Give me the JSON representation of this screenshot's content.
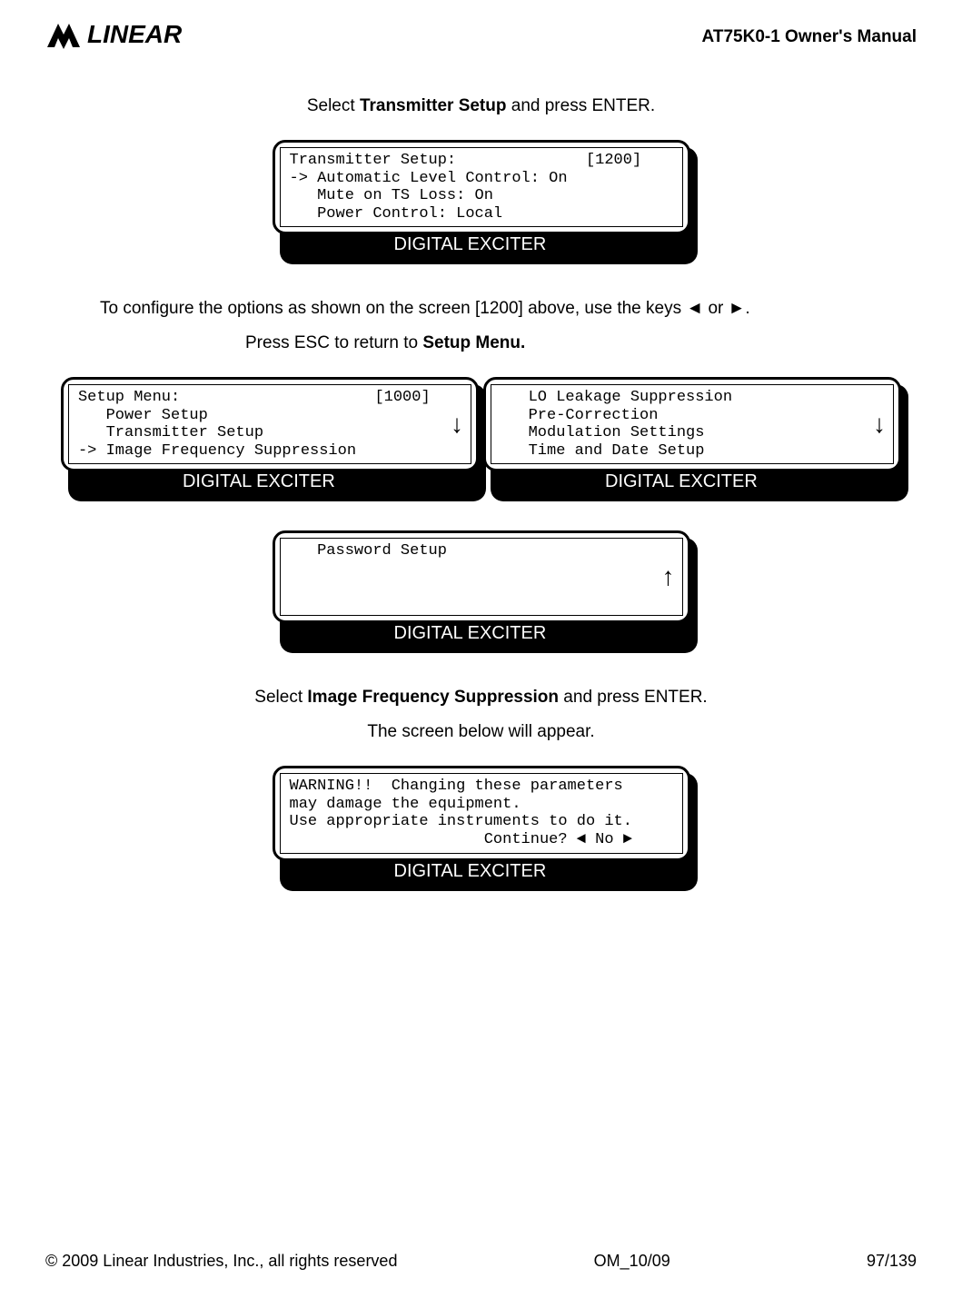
{
  "header": {
    "brand_text": "LINEAR",
    "manual_title": "AT75K0-1 Owner's Manual"
  },
  "paragraphs": {
    "p1_a": "Select ",
    "p1_b": "Transmitter Setup",
    "p1_c": " and press ENTER.",
    "p2": "To configure the options as shown on the screen [1200] above, use the keys ◄ or ►.",
    "p3_a": "Press ESC to return to ",
    "p3_b": "Setup Menu.",
    "p4_a": "Select ",
    "p4_b": "Image Frequency Suppression",
    "p4_c": " and press ENTER.",
    "p5": "The screen below will appear."
  },
  "screens": {
    "label": "DIGITAL EXCITER",
    "s1": "Transmitter Setup:              [1200]\n-> Automatic Level Control: On\n   Mute on TS Loss: On\n   Power Control: Local",
    "s2": "Setup Menu:                     [1000]\n   Power Setup\n   Transmitter Setup\n-> Image Frequency Suppression",
    "s3": "   LO Leakage Suppression\n   Pre-Correction\n   Modulation Settings\n   Time and Date Setup",
    "s4": "   Password Setup\n\n\n",
    "s5": "WARNING!!  Changing these parameters\nmay damage the equipment.\nUse appropriate instruments to do it.\n                     Continue? ◄ No ►"
  },
  "footer": {
    "copyright": "© 2009 Linear Industries, Inc., all rights reserved",
    "doc_id": "OM_10/09",
    "page": "97/139"
  }
}
